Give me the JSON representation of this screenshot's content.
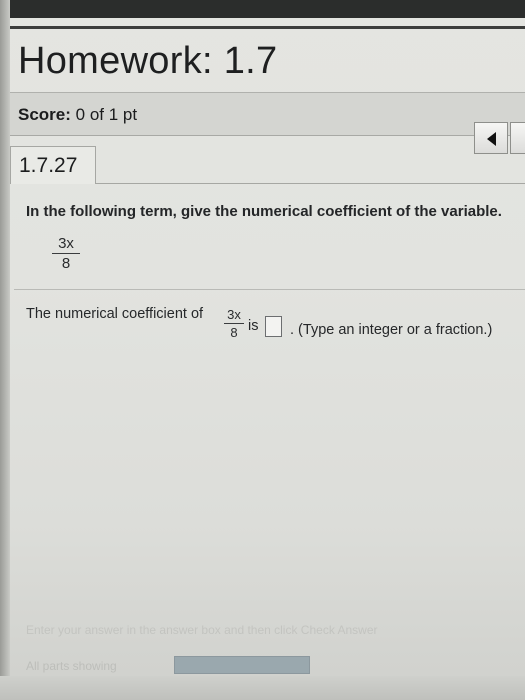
{
  "header": {
    "title": "Homework: 1.7"
  },
  "score": {
    "label": "Score:",
    "value": "0 of 1 pt"
  },
  "problem": {
    "id": "1.7.27",
    "instruction": "In the following term, give the numerical coefficient of the variable.",
    "term": {
      "numerator": "3x",
      "denominator": "8"
    },
    "answer_prefix": "The numerical coefficient of",
    "answer_connector": "is",
    "answer_value": "",
    "answer_hint": ". (Type an integer or a fraction.)"
  },
  "footer": {
    "status_message": "Enter your answer in the answer box and then click Check Answer",
    "parts_label": "All parts showing"
  },
  "icons": {
    "nav_back": "triangle-left-icon"
  },
  "colors": {
    "progress_fill": "#9aa8ae"
  }
}
